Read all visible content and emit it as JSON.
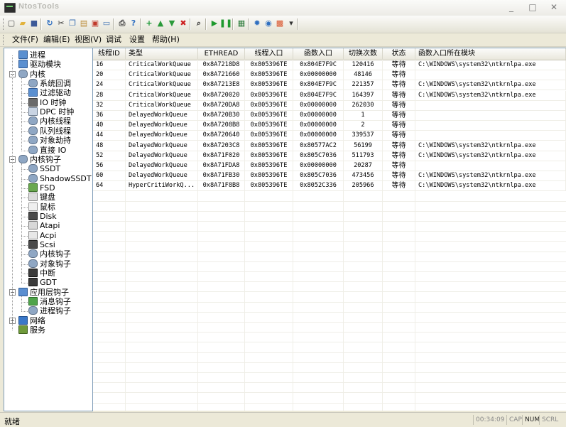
{
  "window": {
    "title": "NtosTools",
    "minimize_glyph": "_",
    "maximize_glyph": "□",
    "close_glyph": "✕"
  },
  "toolbar": {
    "buttons": [
      {
        "name": "new-doc-icon",
        "glyph": "▢",
        "color": "#ffffff"
      },
      {
        "name": "open-folder-icon",
        "glyph": "▰",
        "color": "#e2b33c"
      },
      {
        "name": "save-icon",
        "glyph": "■",
        "color": "#3b5998"
      },
      {
        "name": "refresh-icon",
        "glyph": "↻",
        "color": "#2f6fc0"
      },
      {
        "name": "cut-icon",
        "glyph": "✂",
        "color": "#333333"
      },
      {
        "name": "copy-icon",
        "glyph": "❐",
        "color": "#3a6fb0"
      },
      {
        "name": "paste-icon",
        "glyph": "▤",
        "color": "#b98a35"
      },
      {
        "name": "export-icon",
        "glyph": "▣",
        "color": "#c0392b"
      },
      {
        "name": "window-icon",
        "glyph": "▭",
        "color": "#4a7ab8"
      },
      {
        "name": "print-icon",
        "glyph": "⎙",
        "color": "#444444"
      },
      {
        "name": "help-icon",
        "glyph": "?",
        "color": "#2f6fc0"
      },
      {
        "name": "add-icon",
        "glyph": "+",
        "color": "#1f9a3a"
      },
      {
        "name": "up-arrow-icon",
        "glyph": "▲",
        "color": "#2a9a3a"
      },
      {
        "name": "down-arrow-icon",
        "glyph": "▼",
        "color": "#2a9a3a"
      },
      {
        "name": "delete-icon",
        "glyph": "✖",
        "color": "#cc1f1f"
      },
      {
        "name": "search-icon",
        "glyph": "⌕",
        "color": "#333333"
      },
      {
        "name": "play-icon",
        "glyph": "▶",
        "color": "#1e9a2e"
      },
      {
        "name": "pause-icon",
        "glyph": "❚❚",
        "color": "#1e9a2e"
      },
      {
        "name": "monitor-icon",
        "glyph": "▦",
        "color": "#2a7a3a"
      },
      {
        "name": "settings-icon",
        "glyph": "✹",
        "color": "#2f6fc0"
      },
      {
        "name": "network-icon",
        "glyph": "◉",
        "color": "#2f6fc0"
      },
      {
        "name": "color-palette-icon",
        "glyph": "▩",
        "color": "#d9532b"
      },
      {
        "name": "toolbar-dropdown-icon",
        "glyph": "▾",
        "color": "#333333"
      }
    ]
  },
  "menu": {
    "items": [
      "文件(F)",
      "编辑(E)",
      "视图(V)",
      "调试",
      "设置",
      "帮助(H)"
    ]
  },
  "tree": {
    "nodes": [
      {
        "label": "进程",
        "icon": "monitor-icon",
        "level": 1
      },
      {
        "label": "驱动模块",
        "icon": "monitor-icon",
        "level": 1
      },
      {
        "label": "内核",
        "icon": "gear-icon",
        "level": 0,
        "expander": "−"
      },
      {
        "label": "系统回调",
        "icon": "gear-icon",
        "level": 2
      },
      {
        "label": "过滤驱动",
        "icon": "monitor-icon",
        "level": 2
      },
      {
        "label": "IO 时钟",
        "icon": "io-icon",
        "level": 2
      },
      {
        "label": "DPC 时钟",
        "icon": "clock-icon",
        "level": 2
      },
      {
        "label": "内核线程",
        "icon": "gear-icon",
        "level": 2
      },
      {
        "label": "队列线程",
        "icon": "gear-icon",
        "level": 2
      },
      {
        "label": "对象劫持",
        "icon": "gear-icon",
        "level": 2
      },
      {
        "label": "直接 IO",
        "icon": "gear-icon",
        "level": 2
      },
      {
        "label": "内核钩子",
        "icon": "gear-icon",
        "level": 0,
        "expander": "−"
      },
      {
        "label": "SSDT",
        "icon": "gear-icon",
        "level": 2
      },
      {
        "label": "ShadowSSDT",
        "icon": "gear-icon",
        "level": 2
      },
      {
        "label": "FSD",
        "icon": "fsd-icon",
        "level": 2
      },
      {
        "label": "键盘",
        "icon": "keyboard-icon",
        "level": 2
      },
      {
        "label": "鼠标",
        "icon": "mouse-icon",
        "level": 2
      },
      {
        "label": "Disk",
        "icon": "disk-icon",
        "level": 2
      },
      {
        "label": "Atapi",
        "icon": "atapi-icon",
        "level": 2
      },
      {
        "label": "Acpi",
        "icon": "acpi-icon",
        "level": 2
      },
      {
        "label": "Scsi",
        "icon": "disk-icon",
        "level": 2
      },
      {
        "label": "内核钩子",
        "icon": "gear-icon",
        "level": 2
      },
      {
        "label": "对象钩子",
        "icon": "gear-icon",
        "level": 2
      },
      {
        "label": "中断",
        "icon": "chip-icon",
        "level": 2
      },
      {
        "label": "GDT",
        "icon": "chip-icon",
        "level": 2
      },
      {
        "label": "应用层钩子",
        "icon": "monitor-icon",
        "level": 0,
        "expander": "−"
      },
      {
        "label": "消息钩子",
        "icon": "message-icon",
        "level": 2
      },
      {
        "label": "进程钩子",
        "icon": "gear-icon",
        "level": 2
      },
      {
        "label": "网络",
        "icon": "network-icon",
        "level": 0,
        "expander": "+"
      },
      {
        "label": "服务",
        "icon": "service-icon",
        "level": 0
      }
    ]
  },
  "table": {
    "columns": [
      "线程ID",
      "类型",
      "ETHREAD",
      "线程入口",
      "函数入口",
      "切换次数",
      "状态",
      "函数入口所在模块"
    ],
    "rows": [
      [
        "16",
        "CriticalWorkQueue",
        "0x8A7218D8",
        "0x805396TE",
        "0x804E7F9C",
        "120416",
        "等待",
        "C:\\WINDOWS\\system32\\ntkrnlpa.exe"
      ],
      [
        "20",
        "CriticalWorkQueue",
        "0x8A721660",
        "0x805396TE",
        "0x00000000",
        "48146",
        "等待",
        ""
      ],
      [
        "24",
        "CriticalWorkQueue",
        "0x8A7213E8",
        "0x805396TE",
        "0x804E7F9C",
        "221357",
        "等待",
        "C:\\WINDOWS\\system32\\ntkrnlpa.exe"
      ],
      [
        "28",
        "CriticalWorkQueue",
        "0x8A720020",
        "0x805396TE",
        "0x804E7F9C",
        "164397",
        "等待",
        "C:\\WINDOWS\\system32\\ntkrnlpa.exe"
      ],
      [
        "32",
        "CriticalWorkQueue",
        "0x8A720DA8",
        "0x805396TE",
        "0x00000000",
        "262030",
        "等待",
        ""
      ],
      [
        "36",
        "DelayedWorkQueue",
        "0x8A720B30",
        "0x805396TE",
        "0x00000000",
        "1",
        "等待",
        ""
      ],
      [
        "40",
        "DelayedWorkQueue",
        "0x8A7208B8",
        "0x805396TE",
        "0x00000000",
        "2",
        "等待",
        ""
      ],
      [
        "44",
        "DelayedWorkQueue",
        "0x8A720640",
        "0x805396TE",
        "0x00000000",
        "339537",
        "等待",
        ""
      ],
      [
        "48",
        "DelayedWorkQueue",
        "0x8A7203C8",
        "0x805396TE",
        "0x80577AC2",
        "56199",
        "等待",
        "C:\\WINDOWS\\system32\\ntkrnlpa.exe"
      ],
      [
        "52",
        "DelayedWorkQueue",
        "0x8A71F020",
        "0x805396TE",
        "0x805C7036",
        "511793",
        "等待",
        "C:\\WINDOWS\\system32\\ntkrnlpa.exe"
      ],
      [
        "56",
        "DelayedWorkQueue",
        "0x8A71FDA8",
        "0x805396TE",
        "0x00000000",
        "20287",
        "等待",
        ""
      ],
      [
        "60",
        "DelayedWorkQueue",
        "0x8A71FB30",
        "0x805396TE",
        "0x805C7036",
        "473456",
        "等待",
        "C:\\WINDOWS\\system32\\ntkrnlpa.exe"
      ],
      [
        "64",
        "HyperCritiWorkQ...",
        "0x8A71F8B8",
        "0x805396TE",
        "0x8052C336",
        "205966",
        "等待",
        "C:\\WINDOWS\\system32\\ntkrnlpa.exe"
      ]
    ],
    "empty_rows": 23
  },
  "status": {
    "text": "就绪",
    "time": "00:34:09",
    "indicators": [
      {
        "label": "CAP",
        "on": false
      },
      {
        "label": "NUM",
        "on": true
      },
      {
        "label": "SCRL",
        "on": false
      }
    ]
  }
}
